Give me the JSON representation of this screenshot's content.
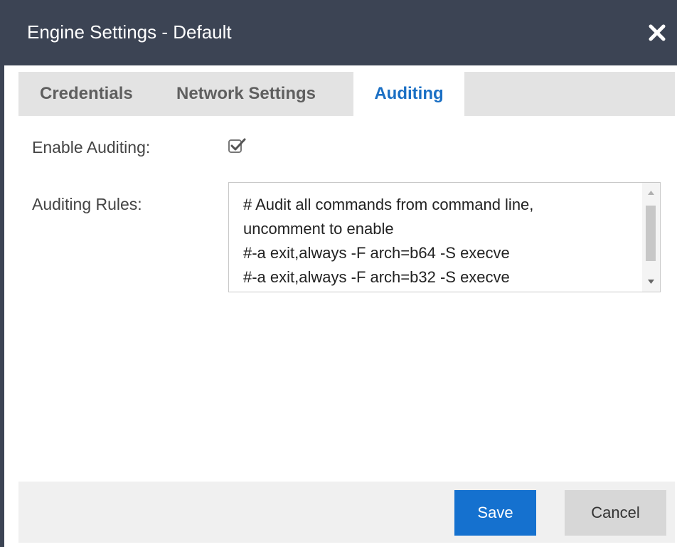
{
  "dialog": {
    "title": "Engine Settings - Default",
    "close_icon": "close-icon"
  },
  "tabs": [
    {
      "label": "Credentials",
      "active": false
    },
    {
      "label": "Network Settings",
      "active": false
    },
    {
      "label": "Auditing",
      "active": true
    }
  ],
  "form": {
    "enable_auditing_label": "Enable Auditing:",
    "enable_auditing_checked": true,
    "auditing_rules_label": "Auditing Rules:",
    "auditing_rules_value": "# Audit all commands from command line,\nuncomment to enable\n#-a exit,always -F arch=b64 -S execve\n#-a exit,always -F arch=b32 -S execve"
  },
  "footer": {
    "save_label": "Save",
    "cancel_label": "Cancel"
  },
  "colors": {
    "titlebar": "#3c4454",
    "active_tab_text": "#1a6fc4",
    "save_button": "#1571cf",
    "cancel_button": "#d7d7d7"
  }
}
